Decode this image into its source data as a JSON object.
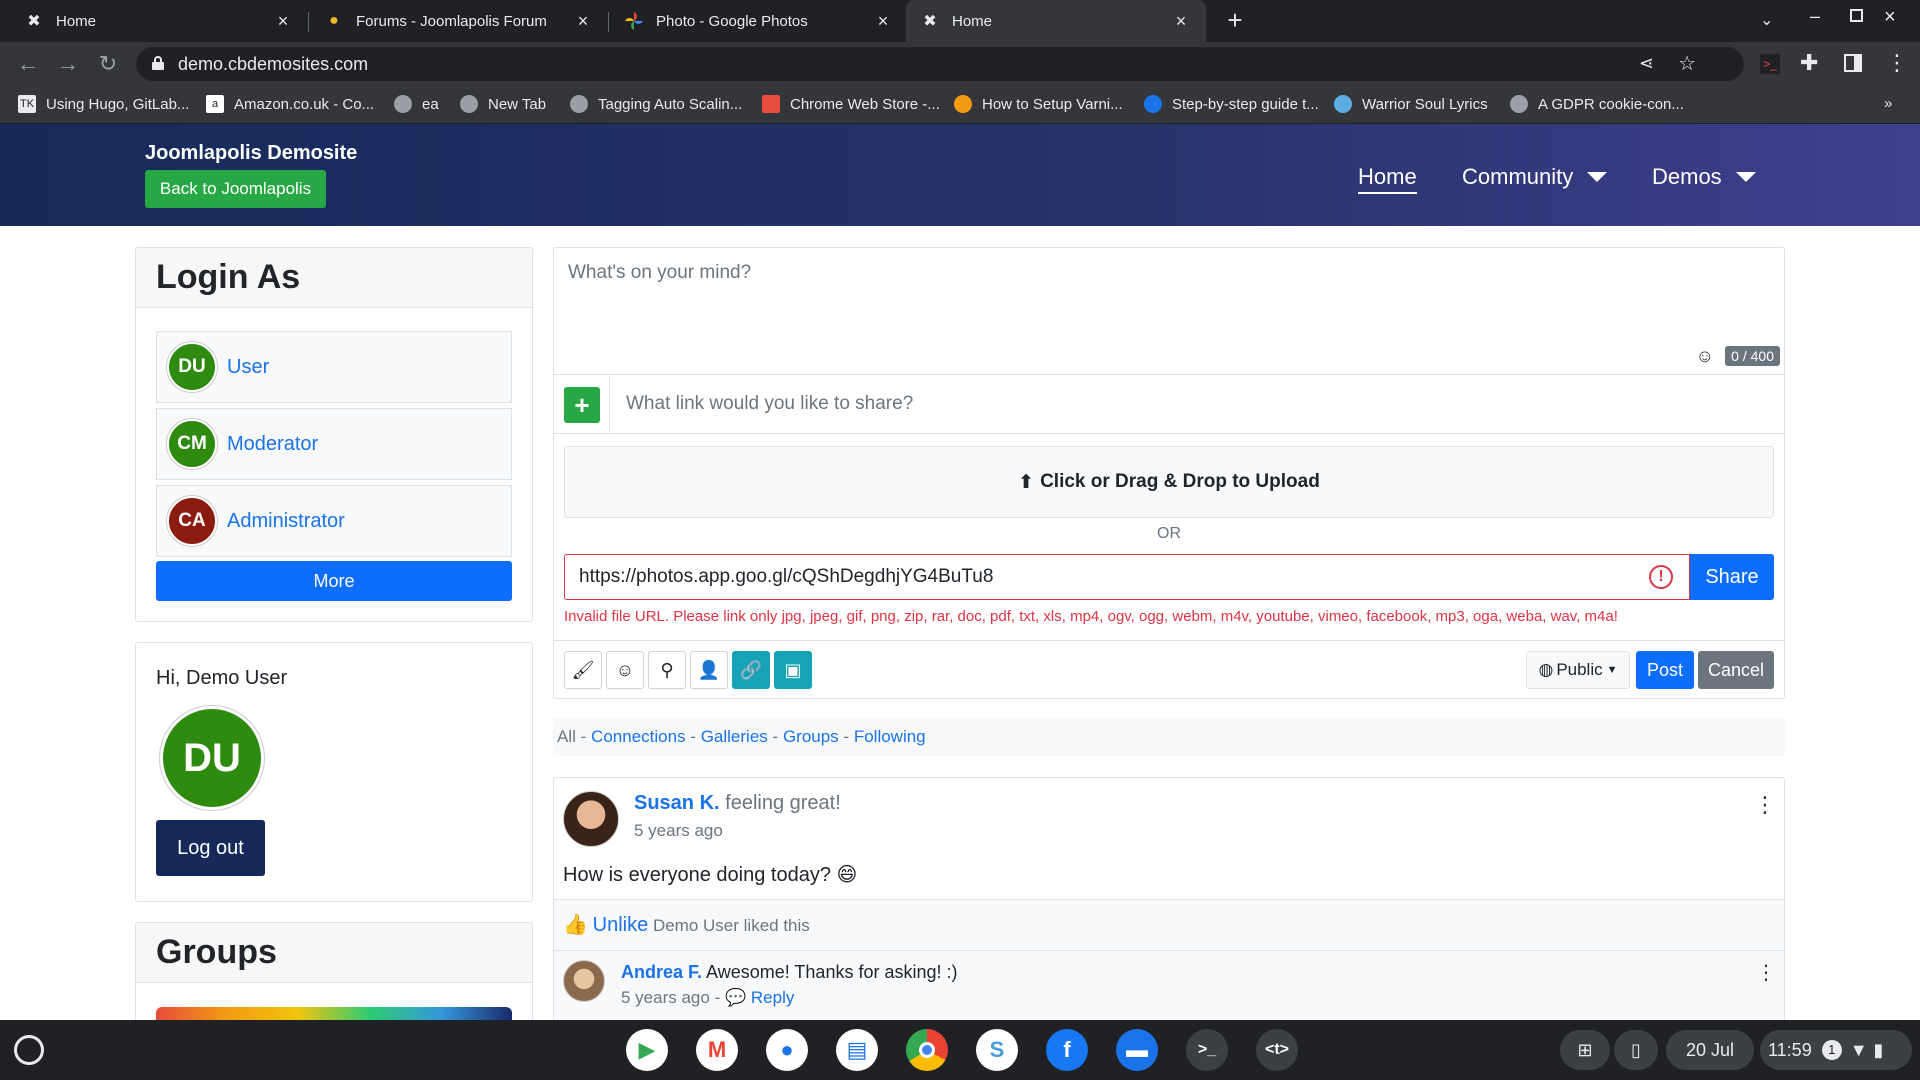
{
  "browser": {
    "tabs": [
      {
        "title": "Home",
        "icon": "joomla-icon"
      },
      {
        "title": "Forums - Joomlapolis Forum",
        "icon": "joomlapolis-icon"
      },
      {
        "title": "Photo - Google Photos",
        "icon": "google-photos-icon"
      },
      {
        "title": "Home",
        "icon": "joomla-icon",
        "active": true
      }
    ],
    "url": "demo.cbdemosites.com",
    "bookmarks": [
      {
        "label": "Using Hugo, GitLab...",
        "icon": "TK"
      },
      {
        "label": "Amazon.co.uk - Co...",
        "icon": "a"
      },
      {
        "label": "ea",
        "icon": ""
      },
      {
        "label": "New Tab",
        "icon": ""
      },
      {
        "label": "Tagging Auto Scalin...",
        "icon": ""
      },
      {
        "label": "Chrome Web Store -...",
        "icon": ""
      },
      {
        "label": "How to Setup Varni...",
        "icon": ""
      },
      {
        "label": "Step-by-step guide t...",
        "icon": ""
      },
      {
        "label": "Warrior Soul Lyrics",
        "icon": ""
      },
      {
        "label": "A GDPR cookie-con...",
        "icon": ""
      }
    ],
    "more_bookmarks": "»"
  },
  "site": {
    "brand": "Joomlapolis Demosite",
    "back_button": "Back to Joomlapolis",
    "nav": [
      "Home",
      "Community",
      "Demos"
    ]
  },
  "login_as": {
    "title": "Login As",
    "users": [
      {
        "initials": "DU",
        "name": "User",
        "color": "#2e8b0f"
      },
      {
        "initials": "CM",
        "name": "Moderator",
        "color": "#2e8b0f"
      },
      {
        "initials": "CA",
        "name": "Administrator",
        "color": "#8b1a0f"
      }
    ],
    "more_button": "More"
  },
  "profile": {
    "greeting": "Hi, Demo User",
    "initials": "DU",
    "logout_button": "Log out"
  },
  "groups": {
    "title": "Groups"
  },
  "composer": {
    "placeholder": "What's on your mind?",
    "char_count": "0 / 400",
    "link_placeholder": "What link would you like to share?",
    "upload_label": "Click or Drag & Drop to Upload",
    "or_label": "OR",
    "url_value": "https://photos.app.goo.gl/cQShDegdhjYG4BuTu8",
    "share_button": "Share",
    "error": "Invalid file URL. Please link only jpg, jpeg, gif, png, zip, rar, doc, pdf, txt, xls, mp4, ogv, ogg, webm, m4v, youtube, vimeo, facebook, mp3, oga, weba, wav, m4a!",
    "privacy": "Public",
    "post_button": "Post",
    "cancel_button": "Cancel"
  },
  "filters": {
    "all": "All",
    "sep": "-",
    "links": [
      "Connections",
      "Galleries",
      "Groups",
      "Following"
    ]
  },
  "post": {
    "author": "Susan K.",
    "feeling": "feeling great!",
    "time": "5 years ago",
    "body": "How is everyone doing today?",
    "emoji": "😄",
    "unlike": "Unlike",
    "liked_by": "Demo User liked this",
    "comment": {
      "author": "Andrea F.",
      "text": "Awesome! Thanks for asking! :)",
      "time": "5 years ago",
      "sep": "-",
      "reply": "Reply"
    }
  },
  "shelf": {
    "date": "20 Jul",
    "time": "11:59",
    "badge": "1"
  }
}
